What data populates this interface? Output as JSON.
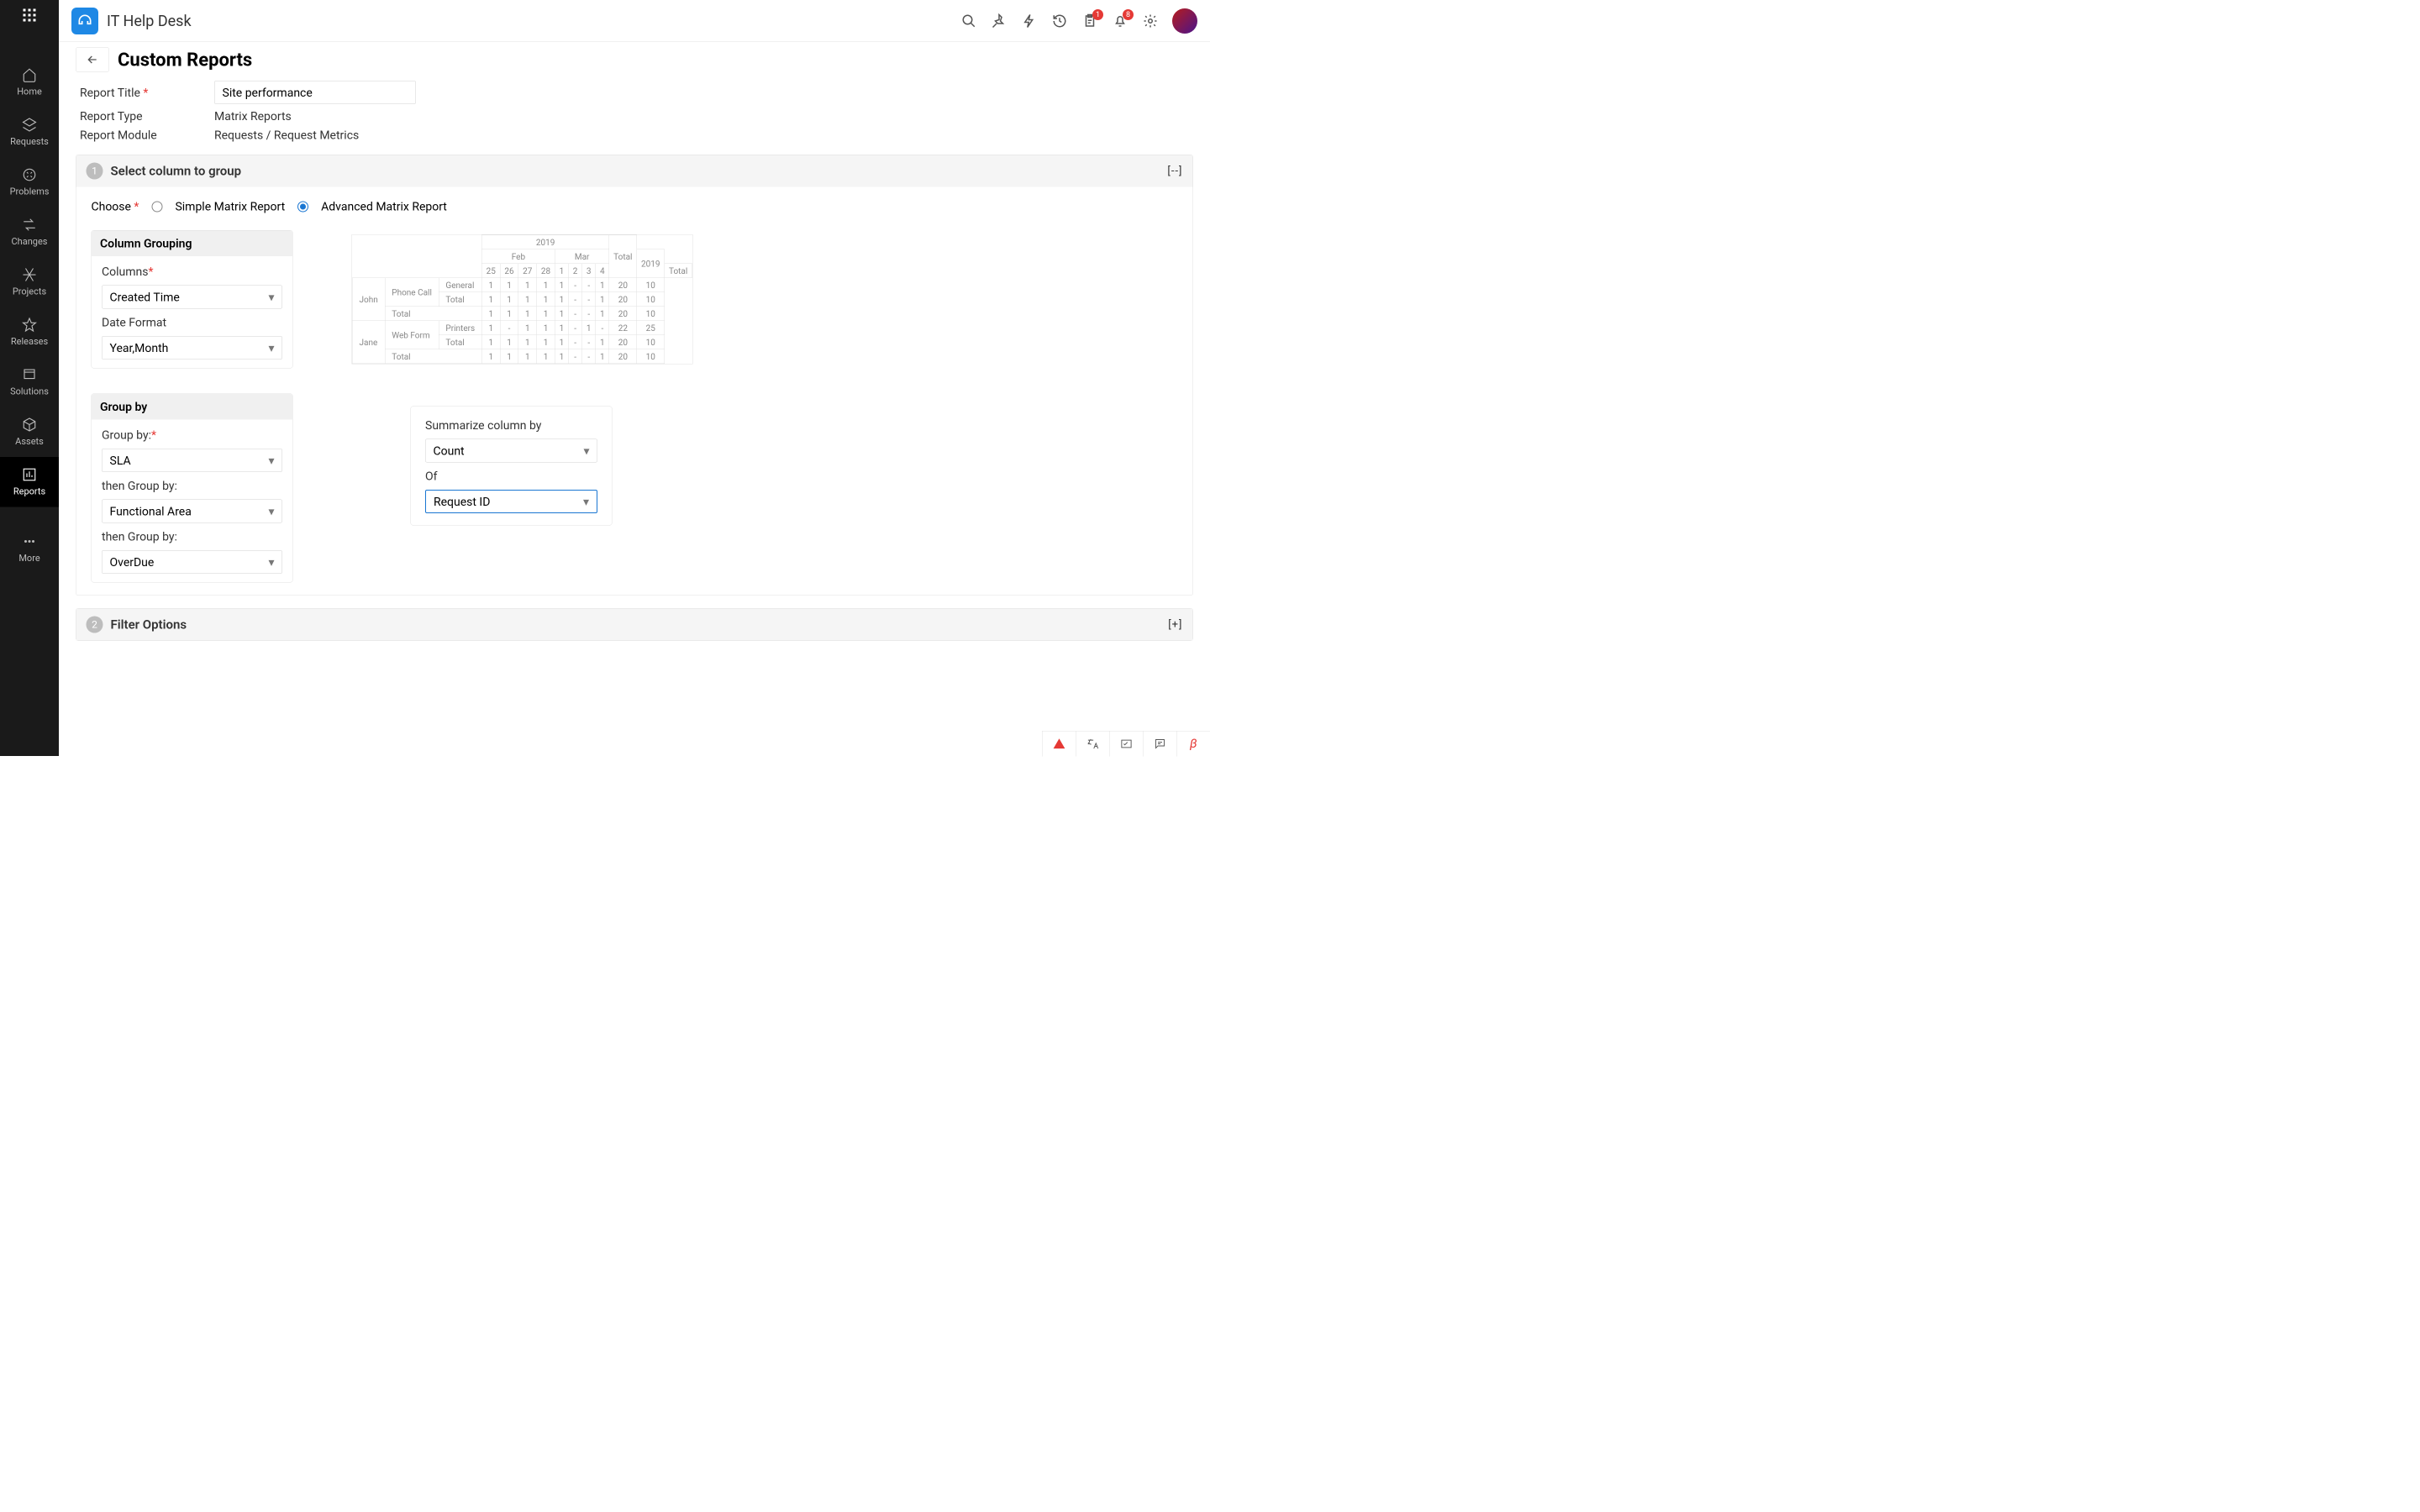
{
  "app_title": "IT Help Desk",
  "badges": {
    "pending": "1",
    "notifications": "8"
  },
  "sidebar": {
    "items": [
      {
        "label": "Home"
      },
      {
        "label": "Requests"
      },
      {
        "label": "Problems"
      },
      {
        "label": "Changes"
      },
      {
        "label": "Projects"
      },
      {
        "label": "Releases"
      },
      {
        "label": "Solutions"
      },
      {
        "label": "Assets"
      },
      {
        "label": "Reports"
      }
    ],
    "more": "More"
  },
  "page": {
    "title": "Custom Reports",
    "report_title_label": "Report Title",
    "report_title_value": "Site performance",
    "report_type_label": "Report Type",
    "report_type_value": "Matrix Reports",
    "report_module_label": "Report Module",
    "report_module_value": "Requests / Request Metrics"
  },
  "section1": {
    "num": "1",
    "title": "Select column to group",
    "collapse": "[--]",
    "choose_label": "Choose",
    "simple": "Simple Matrix Report",
    "advanced": "Advanced Matrix Report",
    "col_group_head": "Column Grouping",
    "columns_label": "Columns",
    "columns_value": "Created Time",
    "date_format_label": "Date Format",
    "date_format_value": "Year,Month",
    "group_by_head": "Group by",
    "group_by_label": "Group by:",
    "group_by_value": "SLA",
    "then1_label": "then Group by:",
    "then1_value": "Functional Area",
    "then2_label": "then Group by:",
    "then2_value": "OverDue",
    "summ_label": "Summarize column by",
    "summ_value": "Count",
    "of_label": "Of",
    "of_value": "Request ID"
  },
  "section2": {
    "num": "2",
    "title": "Filter Options",
    "expand": "[+]"
  },
  "preview": {
    "year": "2019",
    "total": "Total",
    "months": [
      "Feb",
      "Mar",
      "2019"
    ],
    "feb_days": [
      "25",
      "26",
      "27",
      "28"
    ],
    "mar_days": [
      "1",
      "2",
      "3",
      "4"
    ],
    "col_total": "Total",
    "rows": [
      {
        "name": "John",
        "sub": "Phone Call",
        "cat": "General",
        "cells": [
          "1",
          "1",
          "1",
          "1",
          "1",
          "-",
          "-",
          "1",
          "20",
          "10"
        ]
      },
      {
        "name": "",
        "sub": "",
        "cat": "Total",
        "cells": [
          "1",
          "1",
          "1",
          "1",
          "1",
          "-",
          "-",
          "1",
          "20",
          "10"
        ]
      },
      {
        "name": "",
        "sub": "Total",
        "cat": "",
        "cells": [
          "1",
          "1",
          "1",
          "1",
          "1",
          "-",
          "-",
          "1",
          "20",
          "10"
        ]
      },
      {
        "name": "Jane",
        "sub": "Web Form",
        "cat": "Printers",
        "cells": [
          "1",
          "-",
          "1",
          "1",
          "1",
          "-",
          "1",
          "-",
          "22",
          "25"
        ]
      },
      {
        "name": "",
        "sub": "",
        "cat": "Total",
        "cells": [
          "1",
          "1",
          "1",
          "1",
          "1",
          "-",
          "-",
          "1",
          "20",
          "10"
        ]
      },
      {
        "name": "",
        "sub": "Total",
        "cat": "",
        "cells": [
          "1",
          "1",
          "1",
          "1",
          "1",
          "-",
          "-",
          "1",
          "20",
          "10"
        ]
      }
    ]
  }
}
